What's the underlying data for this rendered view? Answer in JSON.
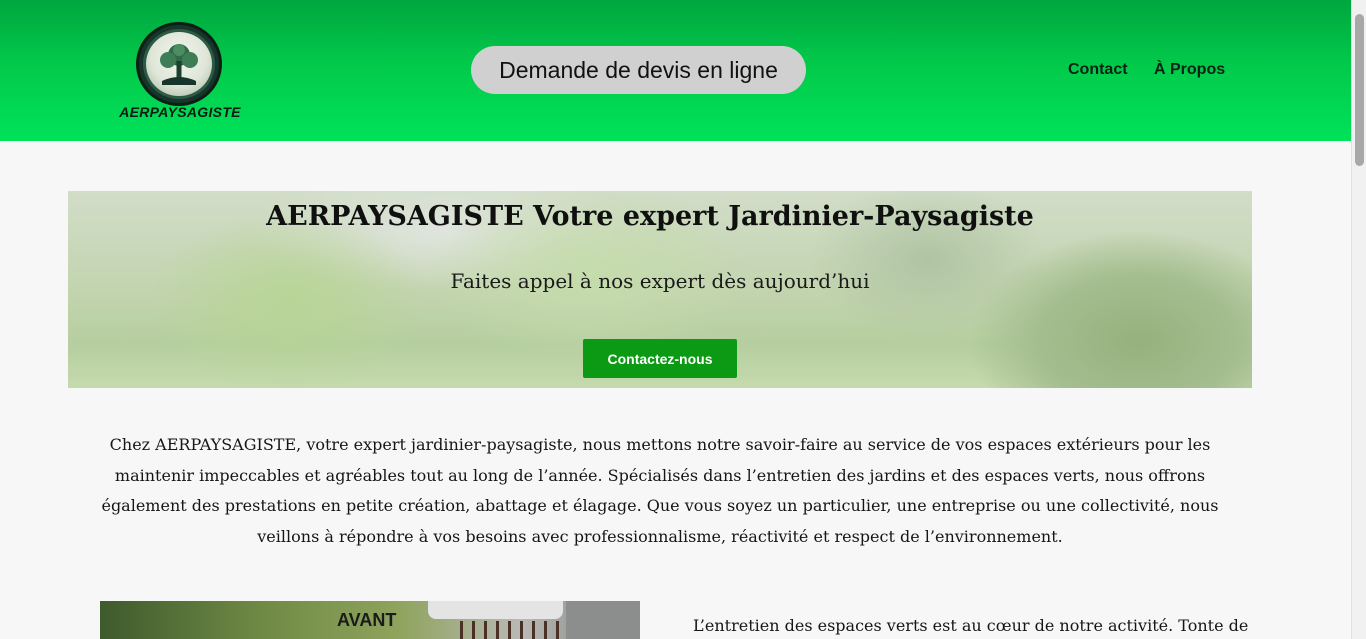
{
  "header": {
    "brand": "AERPAYSAGISTE",
    "quote_button": "Demande de devis en ligne",
    "nav": [
      {
        "label": "Contact"
      },
      {
        "label": "À Propos"
      }
    ]
  },
  "hero": {
    "title": "AERPAYSAGISTE Votre expert Jardinier-Paysagiste",
    "subtitle": "Faites appel à nos expert dès aujourd’hui",
    "cta": "Contactez-nous"
  },
  "intro": {
    "text": "Chez AERPAYSAGISTE, votre expert jardinier-paysagiste, nous mettons notre savoir-faire au service de vos espaces extérieurs pour les maintenir impeccables et agréables tout au long de l’année. Spécialisés dans l’entretien des jardins et des espaces verts, nous offrons également des prestations en petite création, abattage et élagage. Que vous soyez un particulier, une entreprise ou une collectivité, nous veillons à répondre à vos besoins avec professionnalisme, réactivité et respect de l’environnement."
  },
  "section": {
    "before_label": "AVANT",
    "paragraph_start": "L’entretien des espaces verts est au cœur de notre activité. Tonte de"
  },
  "colors": {
    "header_green": "#00c94a",
    "cta_green": "#0c9a14",
    "quote_button_bg": "#d0d0d0"
  },
  "icons": {
    "logo": "tree-logo-icon"
  }
}
